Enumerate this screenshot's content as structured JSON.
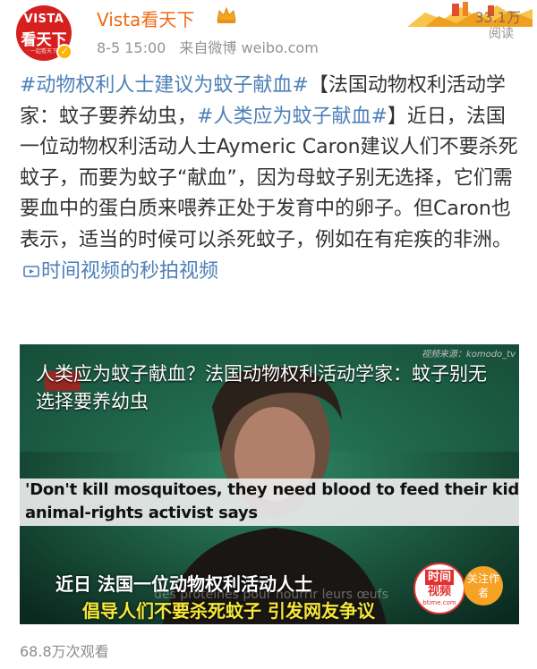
{
  "header": {
    "avatar_top": "VISTA",
    "avatar_mid": "看天下",
    "avatar_bottom": "· 一起看天下 ·",
    "nickname": "Vista看天下",
    "time": "8-5 15:00",
    "source": "来自微博 weibo.com",
    "views_count": "33.1万",
    "views_label": "阅读"
  },
  "post": {
    "tag1": "#动物权利人士建议为蚊子献血#",
    "text1": "【法国动物权利活动学家：蚊子要养幼虫，",
    "tag2": "#人类应为蚊子献血#",
    "text2": "】近日，法国一位动物权利活动人士Aymeric Caron建议人们不要杀死蚊子，而要为蚊子“献血”，因为母蚊子别无选择，它们需要血中的蛋白质来喂养正处于发育中的卵子。但Caron也表示，适当的时候可以杀死蚊子，例如在有疟疾的非洲。",
    "video_link_icon": "video-link-icon",
    "video_link": "时间视频的秒拍视频"
  },
  "video": {
    "title": "人类应为蚊子献血？法国动物权利活动学家：蚊子别无选择要养幼虫",
    "source_watermark": "视频来源：komodo_tv",
    "banner_line1": "'Don't kill mosquitoes, they need blood to feed their kids'",
    "banner_line2": "animal-rights activist says",
    "subtitle1": "近日  法国一位动物权利活动人士",
    "subtitle2": "倡导人们不要杀死蚊子  引发网友争议",
    "french_caption": "des protéines pour nourrir leurs œufs",
    "logo_line1": "时间",
    "logo_line2": "视频",
    "logo_line3": "btime.com",
    "follow_label": "关注作者"
  },
  "footer": {
    "watch_count": "68.8万次观看"
  },
  "colors": {
    "nickname": "#f06a15",
    "link": "#4e80b8",
    "brand_red": "#d62020"
  }
}
